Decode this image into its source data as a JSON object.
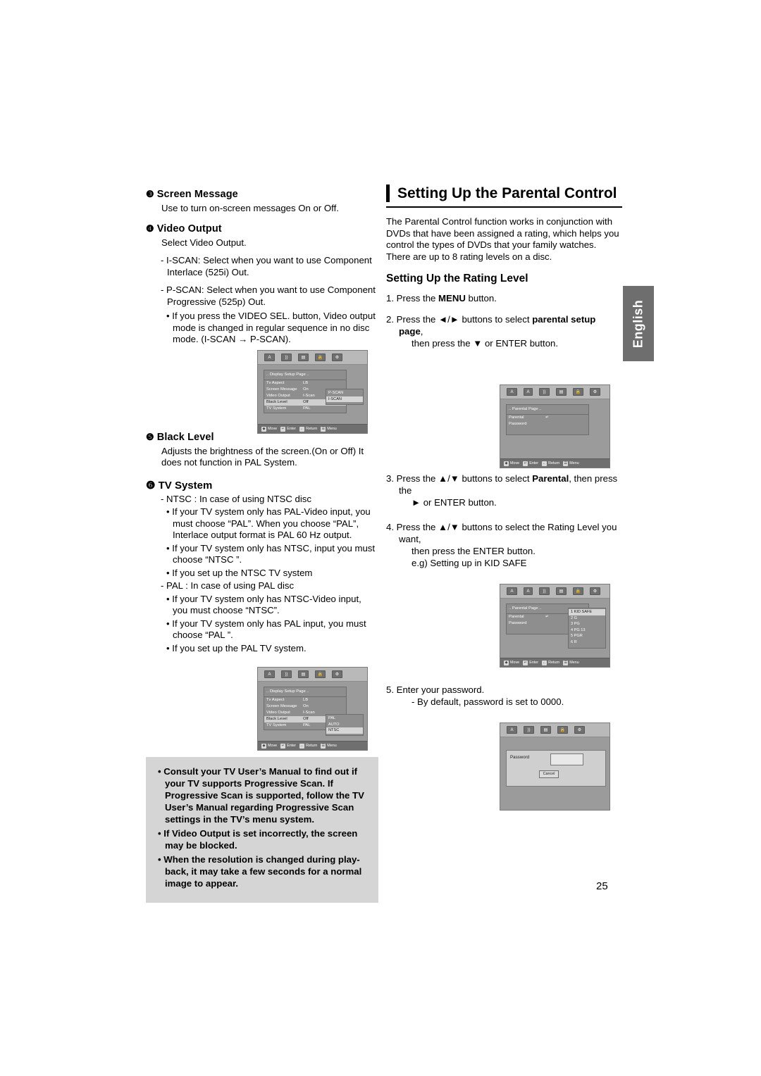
{
  "page_number": "25",
  "side_tab": {
    "label": "English"
  },
  "left_column": {
    "screen_message": {
      "marker": "❸",
      "heading": "Screen Message",
      "body": "Use to turn on-screen messages On or Off."
    },
    "video_output": {
      "marker": "❹",
      "heading": "Video Output",
      "body": "Select Video Output.",
      "items": [
        "- I-SCAN: Select when you want to use Component Interlace (525i) Out.",
        "- P-SCAN: Select when you want to use Component Progressive (525p) Out."
      ],
      "bullet": "• If you press the VIDEO SEL. button, Video output mode is changed in regular sequence in no disc mode. (I-SCAN → P-SCAN)."
    },
    "black_level": {
      "marker": "❺",
      "heading": "Black Level",
      "body": "Adjusts the brightness of the screen.(On or Off) It does not function in PAL System."
    },
    "tv_system": {
      "marker": "❻",
      "heading": "TV System",
      "items": [
        "- NTSC : In case of using NTSC disc",
        "• If your TV system only has PAL-Video input, you must choose “PAL”. When you choose “PAL”, Interlace output format is PAL 60 Hz output.",
        "• If your TV system only has NTSC, input you must choose “NTSC ”.",
        "• If you set up the NTSC TV system",
        "- PAL : In case of using PAL disc",
        "• If your TV system only has NTSC-Video input, you must choose “NTSC”.",
        "• If your TV system only has PAL input, you must choose “PAL ”.",
        "• If you set up the PAL TV system."
      ]
    },
    "note_box": [
      "• Consult your TV User’s Manual to find out if your TV supports Progressive Scan. If Progressive Scan is supported, follow the TV User’s Manual regarding Progressive Scan settings in the TV’s menu system.",
      "• If Video Output is set incorrectly, the screen may be blocked.",
      "• When the resolution is changed during play-back, it may take a few seconds for a normal image to appear."
    ]
  },
  "right_column": {
    "title": "Setting Up the Parental Control",
    "intro": "The Parental Control function works in conjunction with DVDs that have been assigned a rating, which helps you control the types of DVDs that your family watches. There are up to 8 rating levels on a disc.",
    "sub_title": "Setting Up the Rating Level",
    "steps": [
      {
        "n": "1.",
        "text": "Press the ",
        "bold": "MENU",
        "tail": " button."
      },
      {
        "n": "2.",
        "text": "Press the ◄/► buttons to select ",
        "bold": "parental setup page",
        "tail": ",",
        "sub": "then press    the ▼ or ENTER button."
      },
      {
        "n": "3.",
        "text": "Press the ▲/▼ buttons to select ",
        "bold": "Parental",
        "tail": ", then press    the",
        "sub": "► or ENTER button."
      },
      {
        "n": "4.",
        "text": "Press the ▲/▼ buttons to select the Rating Level you want,",
        "sub": "then press the  ENTER button.",
        "sub2": "e.g) Setting up in KID SAFE"
      },
      {
        "n": "5.",
        "text": "Enter your password.",
        "sub": "- By default, password is set to 0000."
      }
    ]
  },
  "osd_screens": {
    "display_setup_pscan": {
      "title": ".. Display Setup Page ..",
      "rows": [
        {
          "label": "Tv Aspect",
          "value": "LB"
        },
        {
          "label": "Screen Message",
          "value": "On"
        },
        {
          "label": "Video Output",
          "value": "I-Scan"
        },
        {
          "label": "Black Level",
          "value": "Off"
        },
        {
          "label": "TV System",
          "value": "PAL"
        }
      ],
      "side_options": [
        "P-SCAN",
        "I-SCAN"
      ],
      "selected_side": "I-SCAN",
      "bottom": [
        "Move",
        "Enter",
        "Return",
        "Menu"
      ],
      "icons": [
        "A■",
        "♪))",
        "‖‖",
        "🔒",
        "⊙"
      ]
    },
    "display_setup_tvsystem": {
      "title": ".. Display Setup Page ..",
      "rows": [
        {
          "label": "Tv Aspect",
          "value": "LB"
        },
        {
          "label": "Screen Message",
          "value": "On"
        },
        {
          "label": "Video Output",
          "value": "I-Scan"
        },
        {
          "label": "Black Level",
          "value": "Off"
        },
        {
          "label": "TV System",
          "value": "PAL"
        }
      ],
      "side_options": [
        "PAL",
        "AUTO",
        "NTSC"
      ],
      "selected_side": "NTSC",
      "bottom": [
        "Move",
        "Enter",
        "Return",
        "Menu"
      ]
    },
    "parental_page": {
      "title": ".. Parental Page ..",
      "rows": [
        {
          "label": "Parental",
          "value": "↵"
        },
        {
          "label": "Password",
          "value": ""
        }
      ],
      "bottom": [
        "Move",
        "Enter",
        "Return",
        "Menu"
      ]
    },
    "parental_rating": {
      "title": ".. Parental Page ..",
      "rows": [
        {
          "label": "Parental",
          "value": "↵"
        },
        {
          "label": "Password",
          "value": ""
        }
      ],
      "side_options": [
        "1 KID SAFE",
        "2 G",
        "3 PG",
        "4 PG 13",
        "5 PGR",
        "6 R"
      ],
      "selected_side": "1 KID SAFE",
      "bottom": [
        "Move",
        "Enter",
        "Return",
        "Menu"
      ]
    },
    "password_screen": {
      "label": "Password",
      "cancel": "Cancel"
    }
  }
}
